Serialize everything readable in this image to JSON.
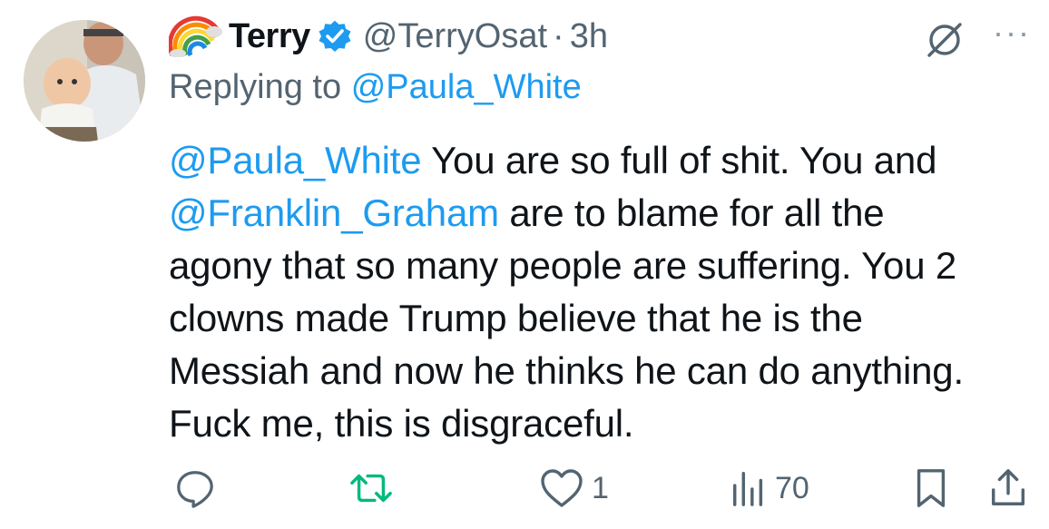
{
  "tweet": {
    "display_name": "Terry",
    "handle": "@TerryOsat",
    "separator": "·",
    "time": "3h",
    "replying_to_prefix": "Replying to",
    "replying_to_handle": "@Paula_White",
    "lines": [
      {
        "mention": "@Paula_White",
        "text": " You are so full of shit. You and"
      },
      {
        "mention": "@Franklin_Graham",
        "text": " are to blame for all the"
      },
      {
        "mention": "",
        "text": "agony that so many people are suffering. You 2"
      },
      {
        "mention": "",
        "text": "clowns made Trump believe that he is the"
      },
      {
        "mention": "",
        "text": "Messiah and now he thinks he can do anything."
      },
      {
        "mention": "",
        "text": "Fuck me, this is disgraceful."
      }
    ]
  },
  "header_icons": {
    "grok": "grok-icon",
    "more": "more-icon",
    "more_glyph": "···"
  },
  "actions": {
    "reply": {
      "icon": "reply-icon"
    },
    "repost": {
      "icon": "repost-icon",
      "color": "#00ba7c"
    },
    "like": {
      "icon": "heart-icon",
      "count": "1"
    },
    "views": {
      "icon": "views-icon",
      "count": "70"
    },
    "bookmark": {
      "icon": "bookmark-icon"
    },
    "share": {
      "icon": "share-icon"
    }
  },
  "colors": {
    "link": "#1d9bf0",
    "secondary": "#536471",
    "text": "#0f1419",
    "verified": "#1d9bf0"
  }
}
